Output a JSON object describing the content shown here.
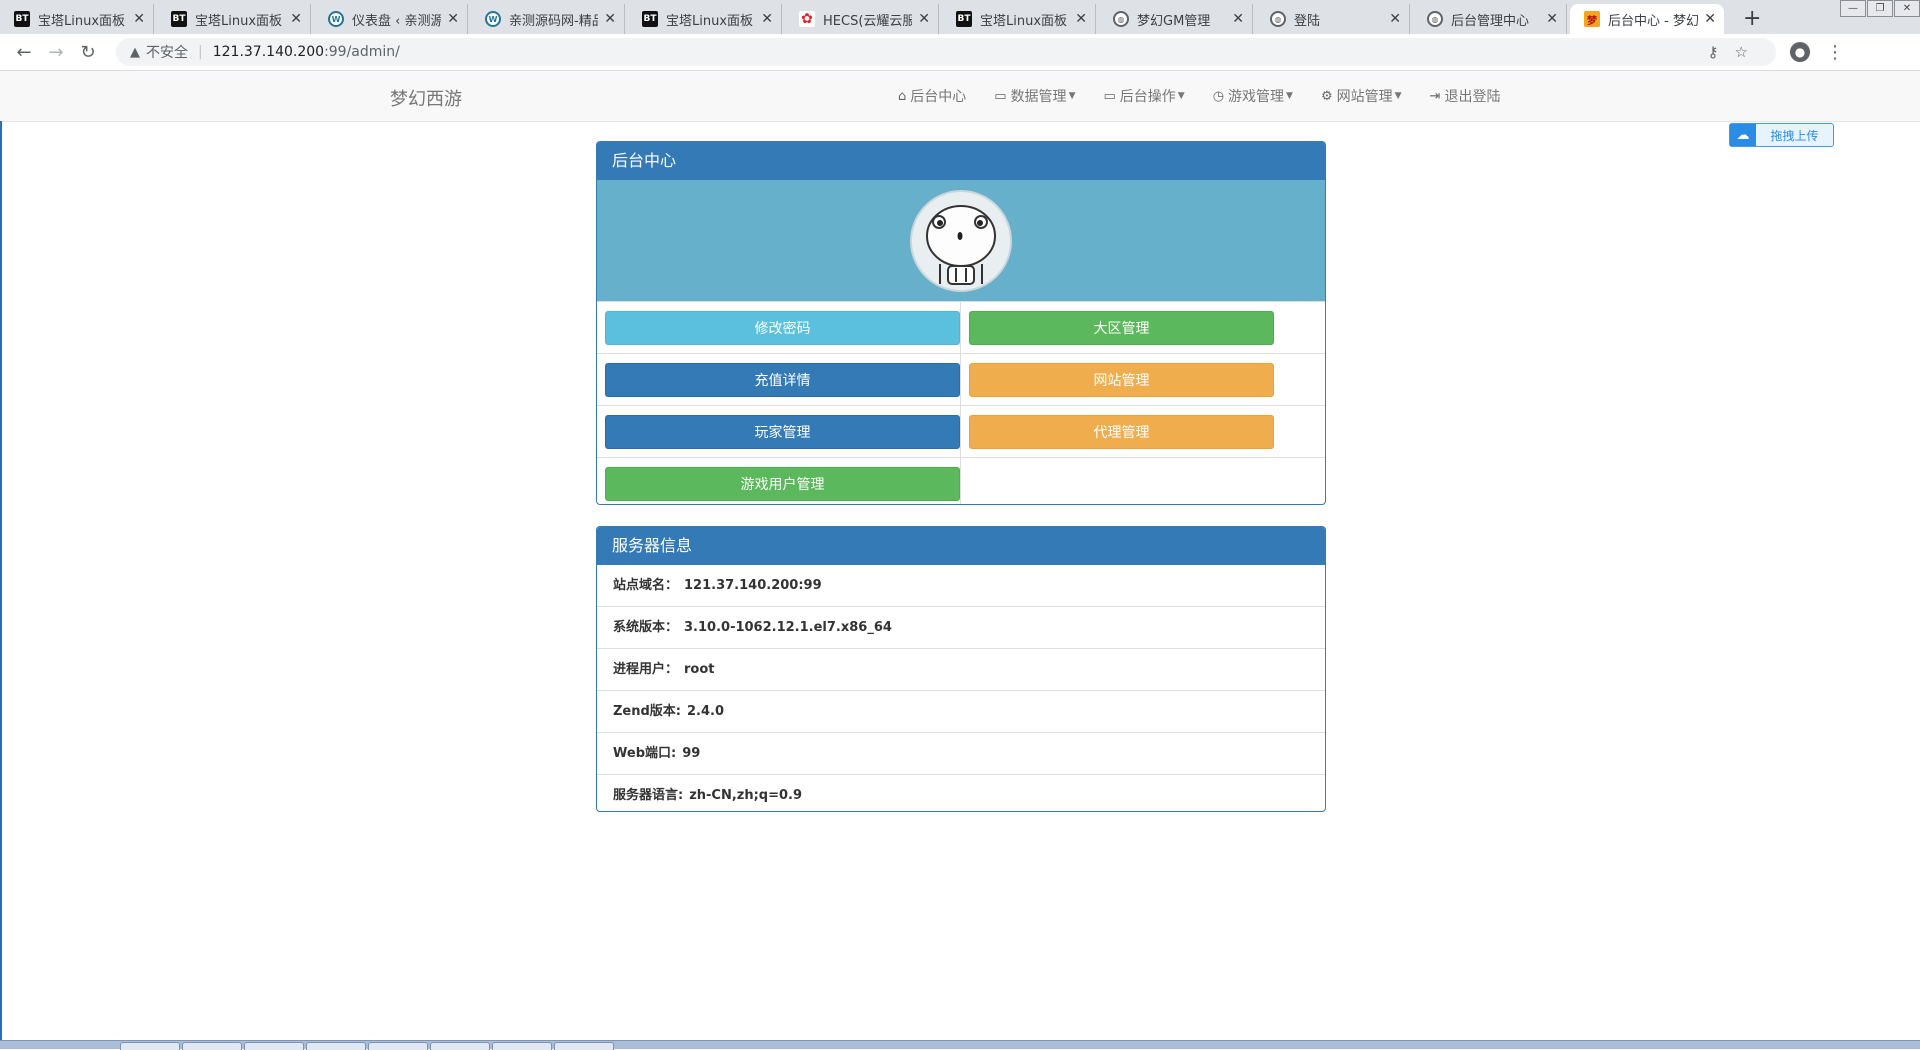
{
  "browser": {
    "tabs": [
      {
        "label": "宝塔Linux面板",
        "icon": "bt-icon",
        "active": false
      },
      {
        "label": "宝塔Linux面板",
        "icon": "bt-icon",
        "active": false
      },
      {
        "label": "仪表盘 ‹ 亲测源码",
        "icon": "wordpress-icon",
        "active": false
      },
      {
        "label": "亲测源码网-精品",
        "icon": "wordpress-icon",
        "active": false
      },
      {
        "label": "宝塔Linux面板",
        "icon": "bt-icon",
        "active": false
      },
      {
        "label": "HECS(云耀云服务",
        "icon": "huawei-icon",
        "active": false
      },
      {
        "label": "宝塔Linux面板",
        "icon": "bt-icon",
        "active": false
      },
      {
        "label": "梦幻GM管理",
        "icon": "globe-icon",
        "active": false
      },
      {
        "label": "登陆",
        "icon": "globe-icon",
        "active": false
      },
      {
        "label": "后台管理中心",
        "icon": "globe-icon",
        "active": false
      },
      {
        "label": "后台中心 - 梦幻西",
        "icon": "game-icon",
        "active": true
      }
    ],
    "new_tab": "+",
    "address": {
      "security_label": "不安全",
      "host": "121.37.140.200",
      "path": ":99/admin/"
    }
  },
  "site": {
    "brand": "梦幻西游",
    "nav": [
      {
        "label": "后台中心",
        "icon": "home-icon",
        "dropdown": false
      },
      {
        "label": "数据管理",
        "icon": "window-icon",
        "dropdown": true
      },
      {
        "label": "后台操作",
        "icon": "window-icon",
        "dropdown": true
      },
      {
        "label": "游戏管理",
        "icon": "clock-icon",
        "dropdown": true
      },
      {
        "label": "网站管理",
        "icon": "gear-icon",
        "dropdown": true
      },
      {
        "label": "退出登陆",
        "icon": "logout-icon",
        "dropdown": false
      }
    ],
    "upload_label": "拖拽上传"
  },
  "panel_admin": {
    "title": "后台中心",
    "buttons": {
      "change_password": "修改密码",
      "region_manage": "大区管理",
      "recharge_detail": "充值详情",
      "site_manage": "网站管理",
      "player_manage": "玩家管理",
      "agent_manage": "代理管理",
      "game_user_manage": "游戏用户管理"
    }
  },
  "panel_server": {
    "title": "服务器信息",
    "rows": [
      {
        "label": "站点域名：",
        "value": "121.37.140.200:99"
      },
      {
        "label": "系统版本：",
        "value": "3.10.0-1062.12.1.el7.x86_64"
      },
      {
        "label": "进程用户：",
        "value": "root"
      },
      {
        "label": "Zend版本:",
        "value": "2.4.0"
      },
      {
        "label": "Web端口:",
        "value": "99"
      },
      {
        "label": "服务器语言:",
        "value": "zh-CN,zh;q=0.9"
      }
    ]
  },
  "colors": {
    "primary": "#337ab7",
    "info": "#5bc0de",
    "success": "#5cb85c",
    "warning": "#f0ad4e",
    "avatar_bg": "#67b0cb"
  }
}
